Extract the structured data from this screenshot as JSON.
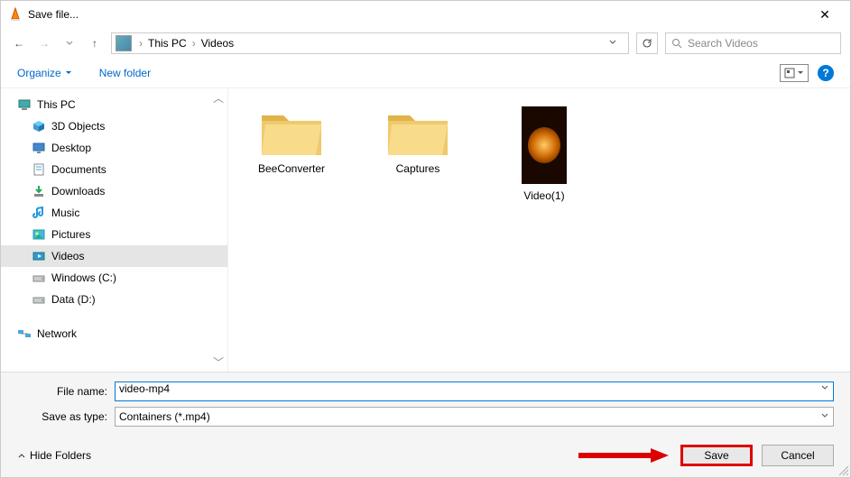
{
  "window": {
    "title": "Save file..."
  },
  "nav": {
    "breadcrumbs": [
      "This PC",
      "Videos"
    ],
    "search_placeholder": "Search Videos"
  },
  "toolbar": {
    "organize": "Organize",
    "new_folder": "New folder"
  },
  "tree": {
    "root": "This PC",
    "items": [
      {
        "label": "3D Objects",
        "icon": "cube"
      },
      {
        "label": "Desktop",
        "icon": "desktop"
      },
      {
        "label": "Documents",
        "icon": "doc"
      },
      {
        "label": "Downloads",
        "icon": "download"
      },
      {
        "label": "Music",
        "icon": "music"
      },
      {
        "label": "Pictures",
        "icon": "pic"
      },
      {
        "label": "Videos",
        "icon": "video",
        "selected": true
      },
      {
        "label": "Windows (C:)",
        "icon": "drive"
      },
      {
        "label": "Data (D:)",
        "icon": "drive"
      }
    ],
    "network": "Network"
  },
  "content": {
    "items": [
      {
        "type": "folder",
        "label": "BeeConverter"
      },
      {
        "type": "folder",
        "label": "Captures"
      },
      {
        "type": "video",
        "label": "Video(1)"
      }
    ]
  },
  "fields": {
    "filename_label": "File name:",
    "filename_value": "video-mp4",
    "filetype_label": "Save as type:",
    "filetype_value": "Containers (*.mp4)"
  },
  "buttons": {
    "hide_folders": "Hide Folders",
    "save": "Save",
    "cancel": "Cancel"
  }
}
